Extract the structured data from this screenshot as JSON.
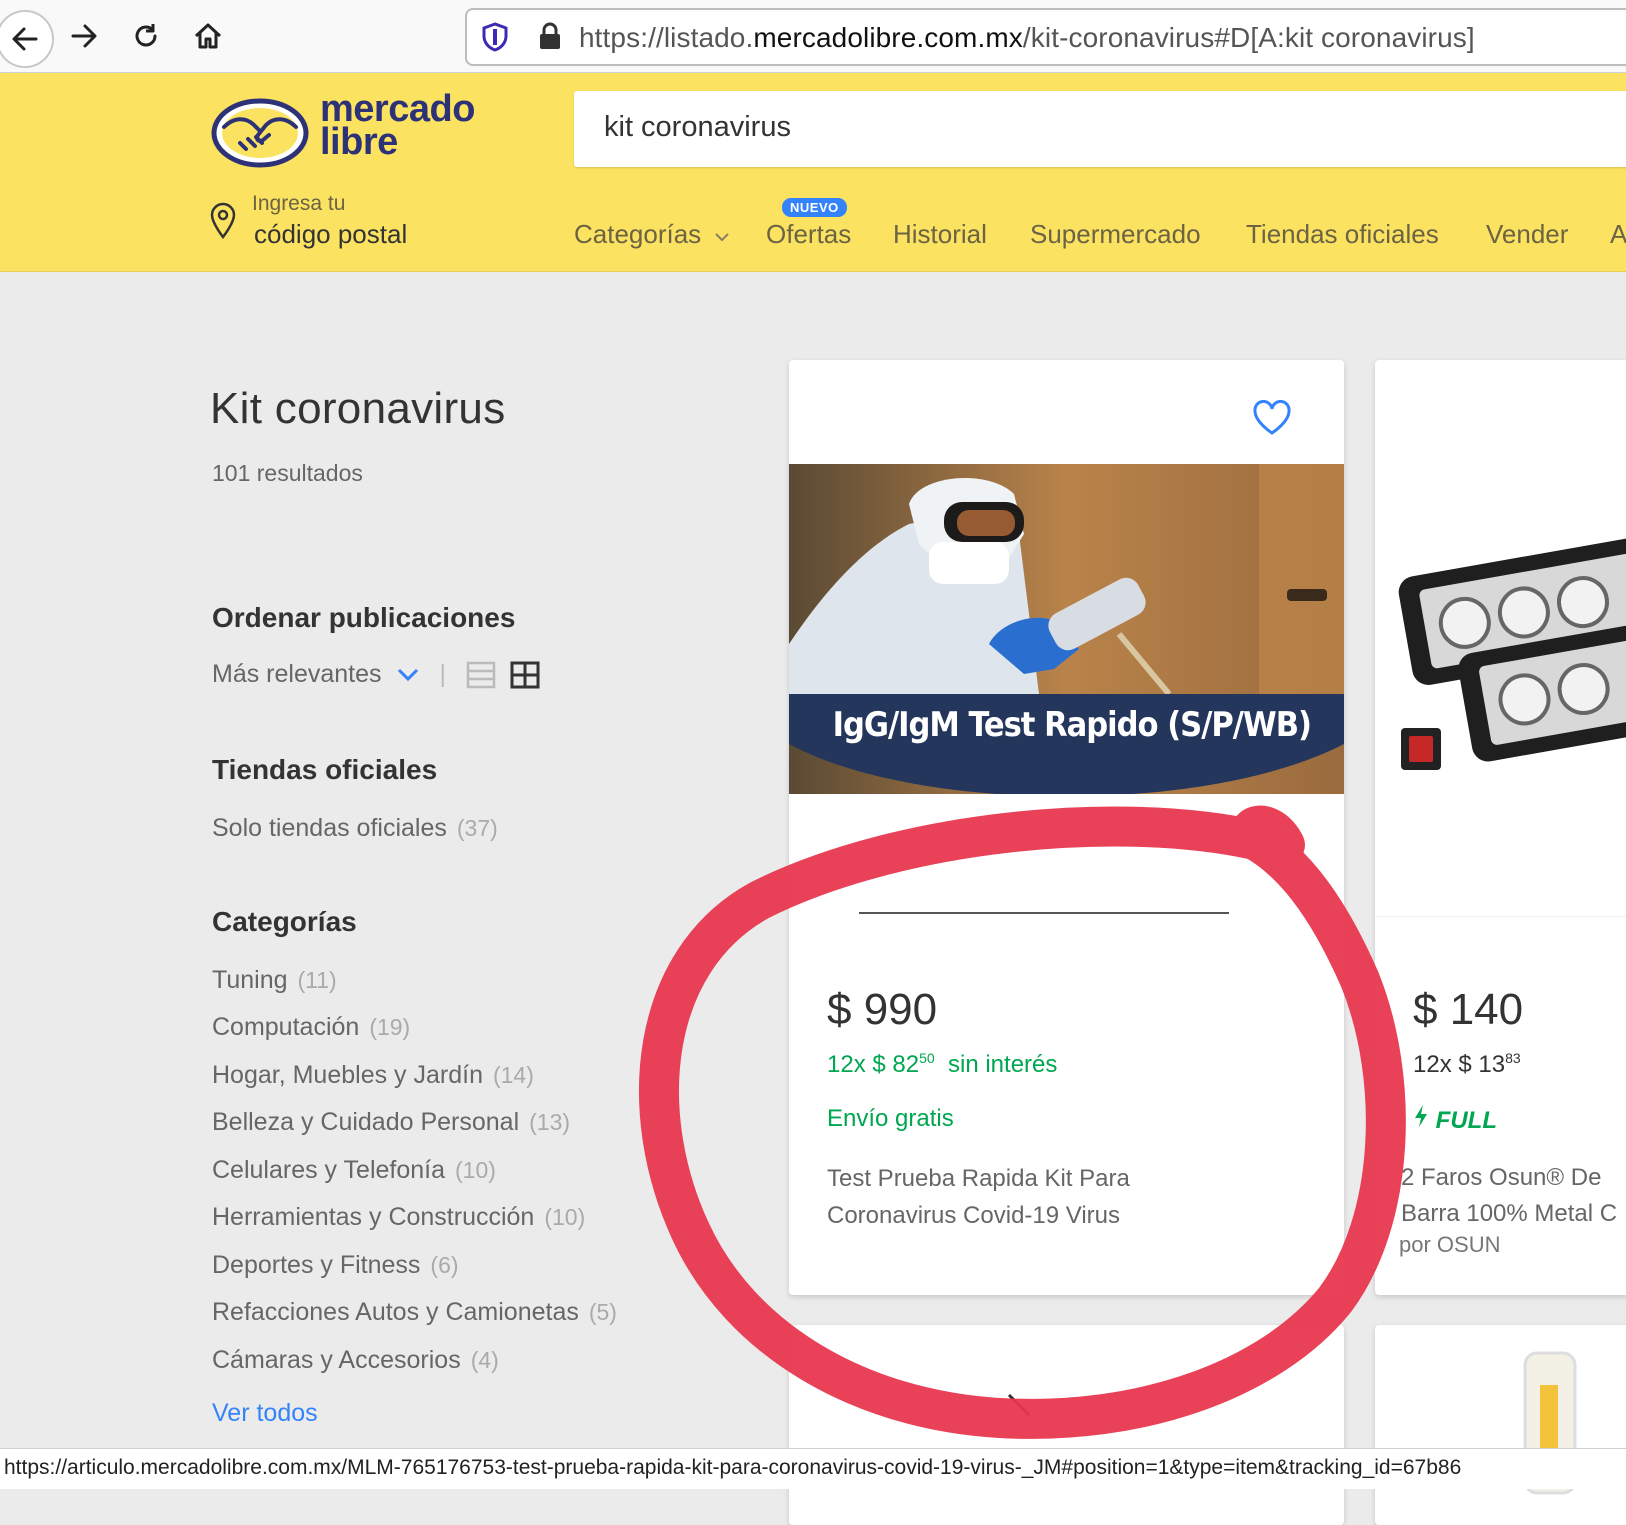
{
  "browser": {
    "url_prefix": "https://listado.",
    "url_domain": "mercadolibre.com.mx",
    "url_suffix": "/kit-coronavirus#D[A:kit coronavirus]",
    "status_url": "https://articulo.mercadolibre.com.mx/MLM-765176753-test-prueba-rapida-kit-para-coronavirus-covid-19-virus-_JM#position=1&type=item&tracking_id=67b86"
  },
  "header": {
    "logo_line1": "mercado",
    "logo_line2": "libre",
    "search_value": "kit coronavirus",
    "location_small": "Ingresa tu",
    "location_big": "código postal",
    "menu": {
      "categorias": "Categorías",
      "ofertas": "Ofertas",
      "nuevo_badge": "NUEVO",
      "historial": "Historial",
      "supermercado": "Supermercado",
      "tiendas": "Tiendas oficiales",
      "vender": "Vender",
      "more": "A"
    },
    "colors": {
      "header_bg": "#fbe361",
      "brand_blue": "#2d3277"
    }
  },
  "sidebar": {
    "title": "Kit coronavirus",
    "results": "101 resultados",
    "sort_title": "Ordenar publicaciones",
    "sort_value": "Más relevantes",
    "official_title": "Tiendas oficiales",
    "official_label": "Solo tiendas oficiales",
    "official_count": "(37)",
    "categories_title": "Categorías",
    "categories": [
      {
        "label": "Tuning",
        "count": "(11)"
      },
      {
        "label": "Computación",
        "count": "(19)"
      },
      {
        "label": "Hogar, Muebles y Jardín",
        "count": "(14)"
      },
      {
        "label": "Belleza y Cuidado Personal",
        "count": "(13)"
      },
      {
        "label": "Celulares y Telefonía",
        "count": "(10)"
      },
      {
        "label": "Herramientas y Construcción",
        "count": "(10)"
      },
      {
        "label": "Deportes y Fitness",
        "count": "(6)"
      },
      {
        "label": "Refacciones Autos y Camionetas",
        "count": "(5)"
      },
      {
        "label": "Cámaras y Accesorios",
        "count": "(4)"
      }
    ],
    "see_all": "Ver todos"
  },
  "products": [
    {
      "image_caption": "IgG/IgM Test Rapido (S/P/WB)",
      "price": "$ 990",
      "installments_prefix": "12x $ 82",
      "installments_cents": "50",
      "installments_suffix": "sin interés",
      "shipping": "Envío gratis",
      "title_line1": "Test Prueba Rapida Kit Para",
      "title_line2": "Coronavirus Covid-19 Virus"
    },
    {
      "price": "$ 140",
      "installments_prefix": "12x $ 13",
      "installments_cents": "83",
      "badge": "FULL",
      "title_line1": "2 Faros Osun® De",
      "title_line2": "Barra 100% Metal C",
      "seller": "por OSUN"
    }
  ],
  "annotation": {
    "color": "#e8374e",
    "shape": "hand-drawn-circle"
  }
}
